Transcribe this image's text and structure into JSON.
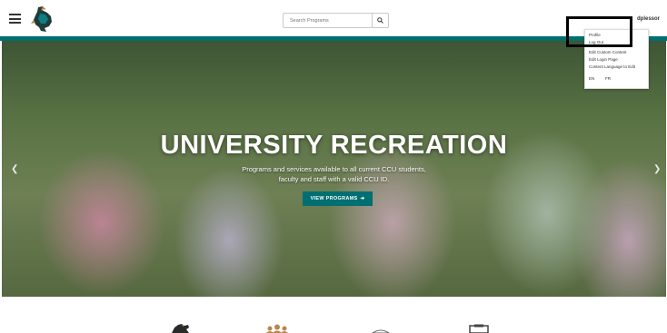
{
  "header": {
    "search_placeholder": "Search Programs",
    "username": "dplessor"
  },
  "hero": {
    "title": "UNIVERSITY RECREATION",
    "subtitle_line1": "Programs and services available to all current CCU students,",
    "subtitle_line2": "faculty and staff with a valid CCU ID.",
    "button_label": "VIEW PROGRAMS",
    "button_arrow": "➔",
    "prev_arrow": "❮",
    "next_arrow": "❯"
  },
  "user_menu": {
    "items": [
      "Profile",
      "Log Out",
      "Edit Custom Content",
      "Edit Login Page",
      "Content Language to Edit"
    ],
    "languages": [
      "EN",
      "FR"
    ]
  },
  "colors": {
    "brand_teal": "#006f71"
  },
  "icons": {
    "menu": "hamburger-icon",
    "logo": "chanticleer-logo",
    "search": "search-icon",
    "bottom": [
      "chanticleer-icon",
      "group-icon",
      "ball-icon",
      "clipboard-icon"
    ]
  }
}
